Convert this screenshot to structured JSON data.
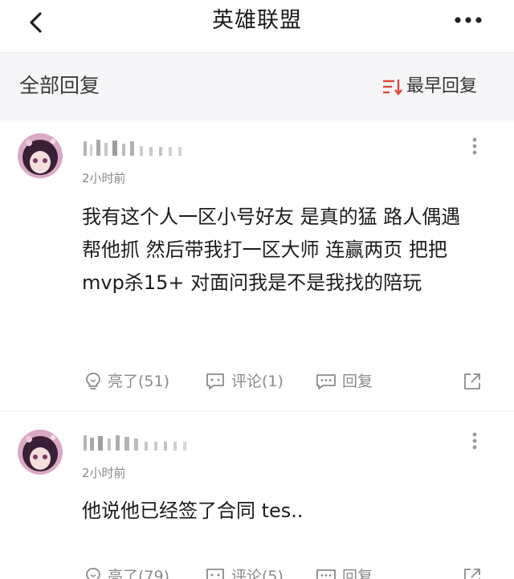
{
  "header": {
    "title": "英雄联盟"
  },
  "section": {
    "title": "全部回复",
    "sort_label": "最早回复"
  },
  "replies": [
    {
      "time": "2小时前",
      "body": "我有这个人一区小号好友 是真的猛 路人偶遇帮他抓 然后带我打一区大师 连赢两页 把把mvp杀15+ 对面问我是不是我找的陪玩",
      "like_label": "亮了(51)",
      "comment_label": "评论(1)",
      "reply_label": "回复"
    },
    {
      "time": "2小时前",
      "body": "他说他已经签了合同 tes..",
      "like_label": "亮了(79)",
      "comment_label": "评论(5)",
      "reply_label": "回复"
    }
  ],
  "icons": {
    "back": "chevron-left-icon",
    "more": "more-horizontal-icon",
    "sort": "sort-icon",
    "reply_menu": "more-vertical-icon",
    "like": "lightbulb-icon",
    "comment": "comment-icon",
    "reply": "reply-bubble-icon",
    "share": "share-icon"
  },
  "colors": {
    "accent": "#e0443a",
    "section_bg": "#f5f5f7",
    "muted_text": "#8a8a8a"
  }
}
